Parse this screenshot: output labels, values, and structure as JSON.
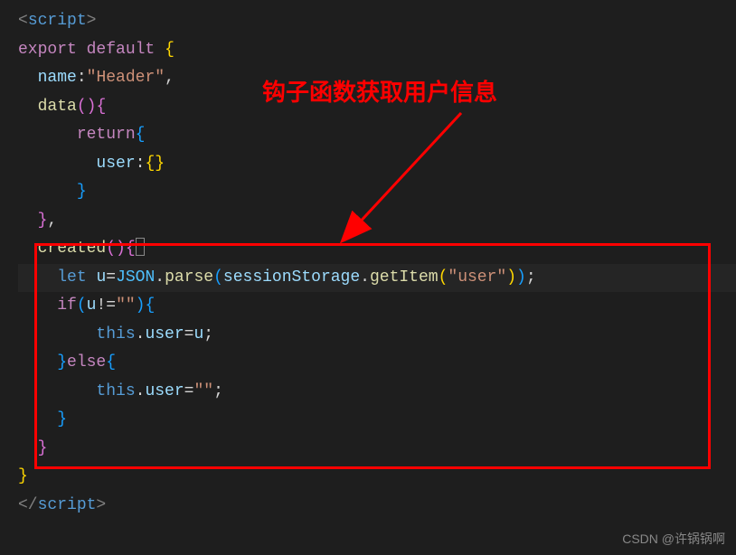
{
  "code": {
    "tag_open": "<",
    "tag_close": ">",
    "tag_end_open": "</",
    "script_tag": "script",
    "export": "export",
    "default": "default",
    "name_key": "name",
    "name_value": "\"Header\"",
    "data_method": "data",
    "return": "return",
    "user_key": "user",
    "created_method": "created",
    "let": "let",
    "u_var": "u",
    "json_obj": "JSON",
    "parse_method": "parse",
    "session_storage": "sessionStorage",
    "get_item": "getItem",
    "user_string": "\"user\"",
    "if": "if",
    "else": "else",
    "this": "this",
    "user_prop": "user",
    "empty_string": "\"\"",
    "not_equal": "!=",
    "equals": "=",
    "colon": ":",
    "comma": ",",
    "semicolon": ";",
    "dot": ".",
    "paren_open": "(",
    "paren_close": ")",
    "brace_open": "{",
    "brace_close": "}"
  },
  "annotation": {
    "text": "钩子函数获取用户信息"
  },
  "watermark": {
    "text": "CSDN @许锅锅啊"
  }
}
